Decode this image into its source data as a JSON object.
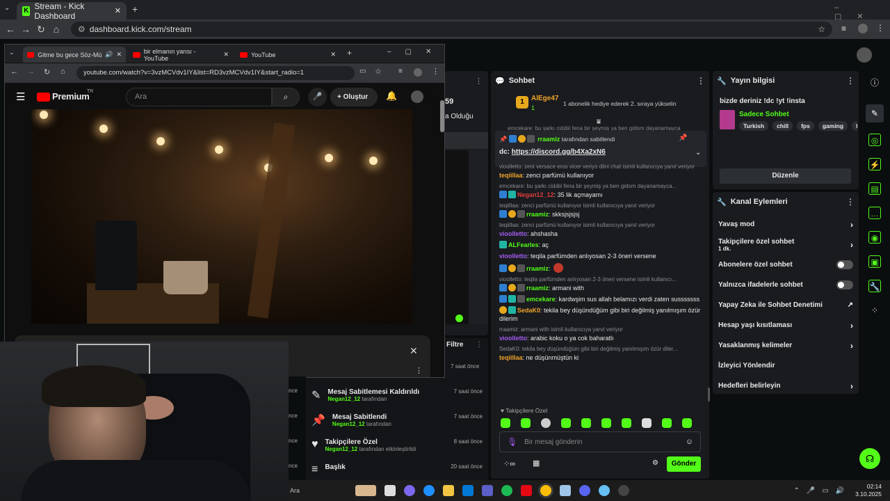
{
  "outer_browser": {
    "tab_title": "Stream - Kick Dashboard",
    "url": "dashboard.kick.com/stream"
  },
  "kick": {
    "partial_panel": {
      "number": "59",
      "text": "a Olduğu"
    },
    "chat": {
      "title": "Sohbet",
      "top_gifter": {
        "name": "AlEge47",
        "count": "1",
        "rank": "1",
        "message": "1 abonelik hediye ederek 2. sıraya yükselin"
      },
      "pinned": {
        "by_user": "rraamiz",
        "by_suffix": "tarafından sabitlendi",
        "label": "dc:",
        "link": "https://discord.gg/b4Xa2xN6",
        "overlay_text": "emcekare: bu şarkı ciddiii fena bir şeymiş ya ben gidom dayanamayca"
      },
      "messages": [
        {
          "reply": "vioolletto: zeni versace eros vicer veriyo diini chat isimli kullanıcıya yanıt veriyor",
          "user": "teqiillaa",
          "color": "#f0a32a",
          "text": "zenci parfümü kullanıyor"
        },
        {
          "reply": "emcekare: bu şarkı ciddiii fena bir şeymiş ya ben gidom dayanamayca...",
          "user": "Negan12_12",
          "color": "#e03c3c",
          "text": "35 lik açmayamı",
          "badges": [
            "b-blue",
            "b-teal"
          ]
        },
        {
          "reply": "teqiillaa: zenci parfümü kullanıyor isimli kullanıcıya yanıt veriyor",
          "user": "rraamiz",
          "color": "#53fc18",
          "text": "skksjsjsjsj",
          "badges": [
            "b-blue",
            "b-gold",
            "b-gray"
          ]
        },
        {
          "reply": "teqiillaa: zenci parfümü kullanıyor isimli kullanıcıya yanıt veriyor",
          "user": "vioolletto",
          "color": "#a35cf0",
          "text": "ahshasha"
        },
        {
          "reply": "",
          "user": "ALFearles",
          "color": "#53fc18",
          "text": "aç",
          "badges": [
            "b-teal"
          ]
        },
        {
          "reply": "",
          "user": "vioolletto",
          "color": "#a35cf0",
          "text": "teqila parfümden anlıyosan 2-3 öneri versene"
        },
        {
          "reply": "",
          "user": "rraamiz",
          "color": "#53fc18",
          "text": "",
          "badges": [
            "b-blue",
            "b-gold",
            "b-gray"
          ]
        },
        {
          "reply": "vioolletto: teqila parfümden anlıyosan 2-3 öneri versene isimli kullanıcı...",
          "user": "rraamiz",
          "color": "#53fc18",
          "text": "armani with",
          "badges": [
            "b-blue",
            "b-gold",
            "b-gray"
          ]
        },
        {
          "reply": "",
          "user": "emcekare",
          "color": "#53fc18",
          "text": "kardwşim sus allah belamızı verdi zaten susssssss",
          "badges": [
            "b-blue",
            "b-teal",
            "b-gray"
          ]
        },
        {
          "reply": "",
          "user": "SedaK0",
          "color": "#f0a32a",
          "text": "tekila bey düşündüğüm gibi biri değilmiş yanılmışım özür dilerim",
          "badges": [
            "b-gold",
            "b-teal"
          ]
        },
        {
          "reply": "rraamiz: armani with isimli kullanıcıya yanıt veriyor",
          "user": "vioolletto",
          "color": "#a35cf0",
          "text": "arabic koku o ya cok baharatlı"
        },
        {
          "reply": "SedaK0: tekila bey düşündüğüm gibi biri değilmiş yanılmışım özür diler...",
          "user": "teqiillaa",
          "color": "#f0a32a",
          "text": "ne düşünmüştün ki"
        }
      ],
      "followers_only_label": "Takipçilere Özel",
      "input_placeholder": "Bir mesaj gönderin",
      "send_label": "Gönder"
    },
    "stream_info": {
      "title": "Yayın bilgisi",
      "stream_title": "bizde deriniz !dc !yt !insta",
      "category": "Sadece Sohbet",
      "tags": [
        "Turkish",
        "chill",
        "fps",
        "gaming",
        "fu"
      ],
      "edit_label": "Düzenle"
    },
    "channel_actions": {
      "title": "Kanal Eylemleri",
      "items": [
        {
          "label": "Yavaş mod",
          "type": "arrow"
        },
        {
          "label": "Takipçilere özel sohbet",
          "sub": "1 dk.",
          "type": "arrow"
        },
        {
          "label": "Abonelere özel sohbet",
          "type": "toggle"
        },
        {
          "label": "Yalnızca ifadelerle sohbet",
          "type": "toggle"
        },
        {
          "label": "Yapay Zeka ile Sohbet Denetimi",
          "type": "external"
        },
        {
          "label": "Hesap yaşı kısıtlaması",
          "type": "arrow"
        },
        {
          "label": "Yasaklanmış kelimeler",
          "type": "arrow"
        },
        {
          "label": "İzleyici Yönlendir",
          "type": "none"
        },
        {
          "label": "Hedefleri belirleyin",
          "type": "arrow"
        }
      ]
    },
    "activity": {
      "filter_label": "Filtre",
      "first_time": "7 saat önce",
      "items": [
        {
          "title": "Mesaj Sabitlemesi Kaldırıldı",
          "user": "Negan12_12",
          "suffix": "tarafından",
          "time": "7 saat önce"
        },
        {
          "title": "Mesaj Sabitlendi",
          "user": "Negan12_12",
          "suffix": "tarafından",
          "time": "7 saat önce"
        },
        {
          "title": "Takipçilere Özel",
          "user": "Negan12_12",
          "suffix": "tarafından etkinleştirildi",
          "time": "8 saat önce"
        },
        {
          "title": "Başlık",
          "user": "",
          "suffix": "",
          "time": "20 saat önce"
        }
      ]
    }
  },
  "youtube_window": {
    "tabs": [
      "Gitme bu gece Söz-Müzik:",
      "bir elmanın yarısı - YouTube",
      "YouTube"
    ],
    "url": "youtube.com/watch?v=3vzMCVdv1IY&list=RD3vzMCVdv1IY&start_radio=1",
    "brand": "Premium",
    "brand_sup": "TR",
    "search_placeholder": "Ara",
    "create_label": "Oluştur"
  },
  "left_partial_times": [
    "nce",
    "nce",
    "nce",
    "nce"
  ],
  "taskbar": {
    "search": "Ara",
    "time": "02:14",
    "date": "3.10.2025"
  }
}
